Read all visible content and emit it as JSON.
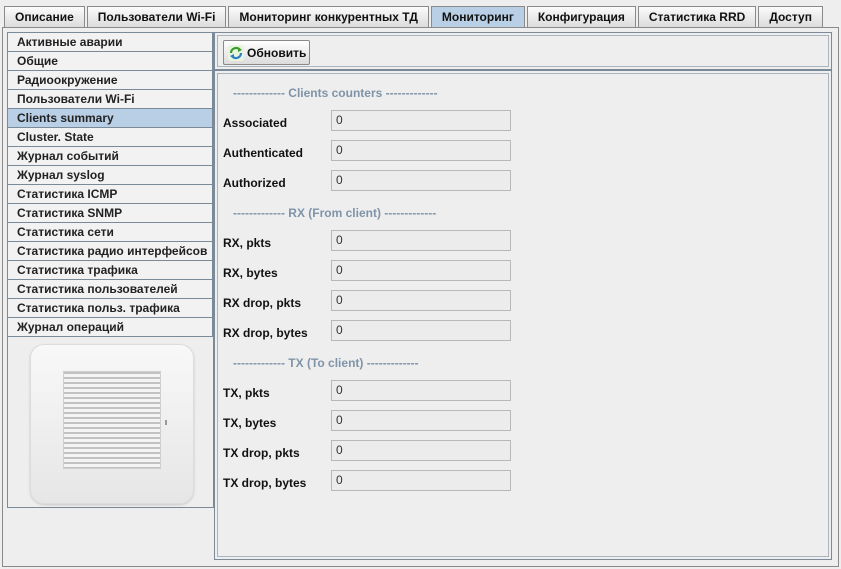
{
  "tabs": [
    {
      "label": "Описание",
      "active": false
    },
    {
      "label": "Пользователи Wi-Fi",
      "active": false
    },
    {
      "label": "Мониторинг конкурентных ТД",
      "active": false
    },
    {
      "label": "Мониторинг",
      "active": true
    },
    {
      "label": "Конфигурация",
      "active": false
    },
    {
      "label": "Статистика RRD",
      "active": false
    },
    {
      "label": "Доступ",
      "active": false
    }
  ],
  "sidebar": {
    "items": [
      {
        "label": "Активные аварии"
      },
      {
        "label": "Общие"
      },
      {
        "label": "Радиоокружение"
      },
      {
        "label": "Пользователи Wi-Fi"
      },
      {
        "label": "Clients summary",
        "selected": true
      },
      {
        "label": "Cluster. State"
      },
      {
        "label": "Журнал событий"
      },
      {
        "label": "Журнал syslog"
      },
      {
        "label": "Статистика ICMP"
      },
      {
        "label": "Статистика SNMP"
      },
      {
        "label": "Статистика сети"
      },
      {
        "label": "Статистика радио интерфейсов"
      },
      {
        "label": "Статистика трафика"
      },
      {
        "label": "Статистика пользователей"
      },
      {
        "label": "Статистика польз. трафика"
      },
      {
        "label": "Журнал операций"
      }
    ]
  },
  "toolbar": {
    "refresh_label": "Обновить"
  },
  "sections": {
    "clients": "------------- Clients counters -------------",
    "rx": "------------- RX (From client) -------------",
    "tx": "------------- TX (To client) -------------"
  },
  "fields": {
    "associated": {
      "label": "Associated",
      "value": "0"
    },
    "authenticated": {
      "label": "Authenticated",
      "value": "0"
    },
    "authorized": {
      "label": "Authorized",
      "value": "0"
    },
    "rx_pkts": {
      "label": "RX, pkts",
      "value": "0"
    },
    "rx_bytes": {
      "label": "RX, bytes",
      "value": "0"
    },
    "rx_drop_pkts": {
      "label": "RX drop, pkts",
      "value": "0"
    },
    "rx_drop_bytes": {
      "label": "RX drop, bytes",
      "value": "0"
    },
    "tx_pkts": {
      "label": "TX, pkts",
      "value": "0"
    },
    "tx_bytes": {
      "label": "TX, bytes",
      "value": "0"
    },
    "tx_drop_pkts": {
      "label": "TX drop, pkts",
      "value": "0"
    },
    "tx_drop_bytes": {
      "label": "TX drop, bytes",
      "value": "0"
    }
  },
  "icons": {
    "refresh": "refresh-icon"
  },
  "colors": {
    "selected": "#b8cfe5",
    "section_text": "#7f94a8",
    "border": "#7a8a99"
  }
}
